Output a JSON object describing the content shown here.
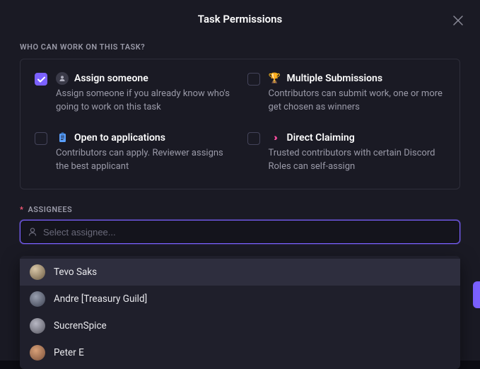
{
  "header": {
    "title": "Task Permissions"
  },
  "section_label": "WHO CAN WORK ON THIS TASK?",
  "options": {
    "assign": {
      "title": "Assign someone",
      "desc": "Assign someone if you already know who's going to work on this task",
      "checked": true
    },
    "multi": {
      "title": "Multiple Submissions",
      "desc": "Contributors can submit work, one or more get chosen as winners",
      "checked": false
    },
    "open": {
      "title": "Open to applications",
      "desc": "Contributors can apply. Reviewer assigns the best applicant",
      "checked": false
    },
    "direct": {
      "title": "Direct Claiming",
      "desc": "Trusted contributors with certain Discord Roles can self-assign",
      "checked": false
    }
  },
  "assignees": {
    "label": "ASSIGNEES",
    "placeholder": "Select assignee...",
    "options": [
      {
        "name": "Tevo Saks"
      },
      {
        "name": "Andre [Treasury Guild]"
      },
      {
        "name": "SucrenSpice"
      },
      {
        "name": "Peter E"
      }
    ]
  }
}
